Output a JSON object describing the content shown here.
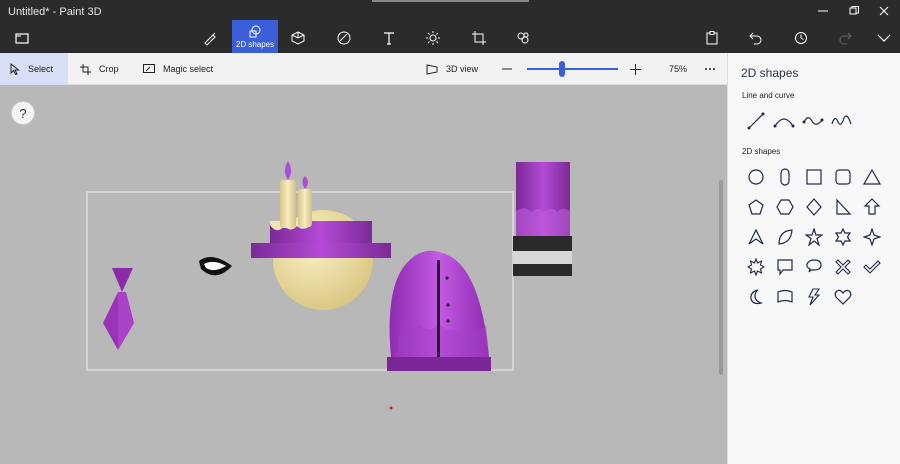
{
  "window": {
    "title": "Untitled* - Paint 3D"
  },
  "toolbar": {
    "tools": [
      {
        "name": "brushes",
        "icon": "brush-icon"
      },
      {
        "name": "2d-shapes",
        "icon": "2d-shapes-icon",
        "label": "2D shapes",
        "active": true
      },
      {
        "name": "3d-shapes",
        "icon": "cube-icon"
      },
      {
        "name": "stickers",
        "icon": "sticker-icon"
      },
      {
        "name": "text",
        "icon": "text-icon"
      },
      {
        "name": "effects",
        "icon": "effects-icon"
      },
      {
        "name": "canvas",
        "icon": "canvas-icon"
      },
      {
        "name": "3d-library",
        "icon": "3d-library-icon"
      }
    ]
  },
  "subbar": {
    "select": "Select",
    "crop": "Crop",
    "magic_select": "Magic select",
    "view_3d": "3D view",
    "zoom": "75%",
    "zoom_level": 0.38
  },
  "canvas": {
    "help": "?"
  },
  "panel": {
    "title": "2D shapes",
    "line_section": "Line and curve",
    "shapes_section": "2D shapes",
    "lines": [
      "line-icon",
      "curve-icon",
      "wave-icon",
      "multi-curve-icon"
    ],
    "shapes": [
      "circle-icon",
      "pill-icon",
      "square-icon",
      "rounded-square-icon",
      "triangle-icon",
      "pentagon-icon",
      "hexagon-icon",
      "diamond-icon",
      "right-triangle-icon",
      "arrow-up-icon",
      "arrow-triangle-icon",
      "leaf-icon",
      "star5-icon",
      "star6-icon",
      "star4-icon",
      "burst-icon",
      "speech-rect-icon",
      "speech-oval-icon",
      "cross-icon",
      "check-icon",
      "moon-icon",
      "flag-icon",
      "lightning-icon",
      "heart-icon"
    ]
  },
  "colors": {
    "accent": "#3a5fd8",
    "purple": "#9b30c0",
    "dark_purple": "#6a1f82",
    "cream": "#efe1a3"
  }
}
